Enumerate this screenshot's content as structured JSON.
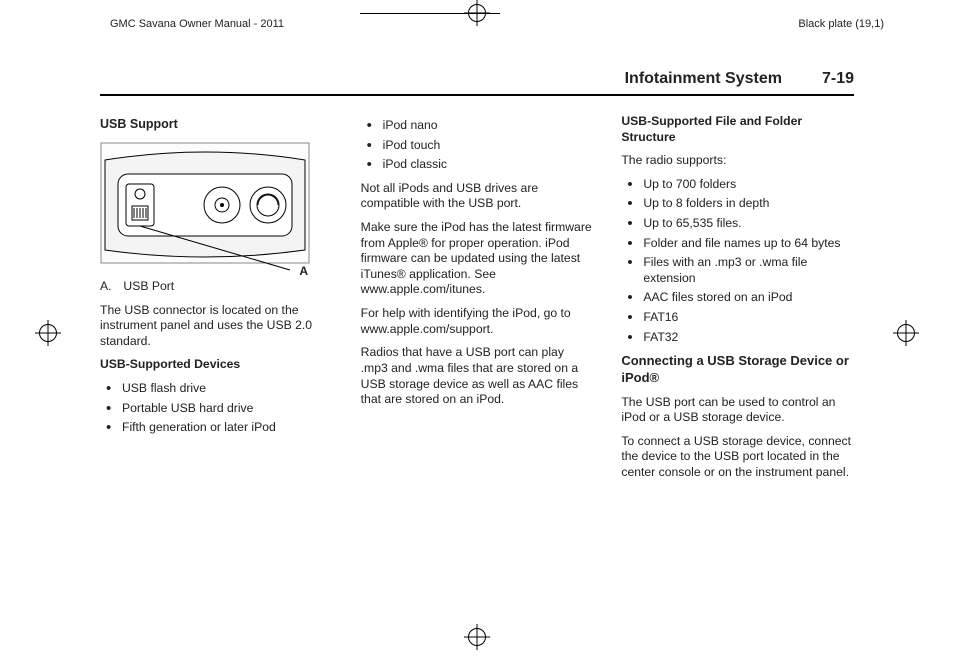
{
  "meta": {
    "manual_title": "GMC Savana Owner Manual - 2011",
    "plate_label": "Black plate (19,1)"
  },
  "header": {
    "section": "Infotainment System",
    "page": "7-19"
  },
  "col1": {
    "h_usb_support": "USB Support",
    "label_a_tag": "A.",
    "label_a_text": "USB Port",
    "p_connector": "The USB connector is located on the instrument panel and uses the USB 2.0 standard.",
    "h_devices": "USB-Supported Devices",
    "devices": [
      "USB flash drive",
      "Portable USB hard drive",
      "Fifth generation or later iPod"
    ]
  },
  "col2": {
    "ipods": [
      "iPod nano",
      "iPod touch",
      "iPod classic"
    ],
    "p_compat": "Not all iPods and USB drives are compatible with the USB port.",
    "p_firmware": "Make sure the iPod has the latest firmware from Apple® for proper operation. iPod firmware can be updated using the latest iTunes® application. See www.apple.com/itunes.",
    "p_help": "For help with identifying the iPod, go to www.apple.com/support.",
    "p_radios": "Radios that have a USB port can play .mp3 and .wma files that are stored on a USB storage device as well as AAC files that are stored on an iPod."
  },
  "col3": {
    "h_struct": "USB-Supported File and Folder Structure",
    "p_supports": "The radio supports:",
    "struct_items": [
      "Up to 700 folders",
      "Up to 8 folders in depth",
      "Up to 65,535 files.",
      "Folder and file names up to 64 bytes",
      "Files with an .mp3 or .wma file extension",
      "AAC files stored on an iPod",
      "FAT16",
      "FAT32"
    ],
    "h_connect": "Connecting a USB Storage Device or iPod®",
    "p_portuse": "The USB port can be used to control an iPod or a USB storage device.",
    "p_connect": "To connect a USB storage device, connect the device to the USB port located in the center console or on the instrument panel."
  }
}
